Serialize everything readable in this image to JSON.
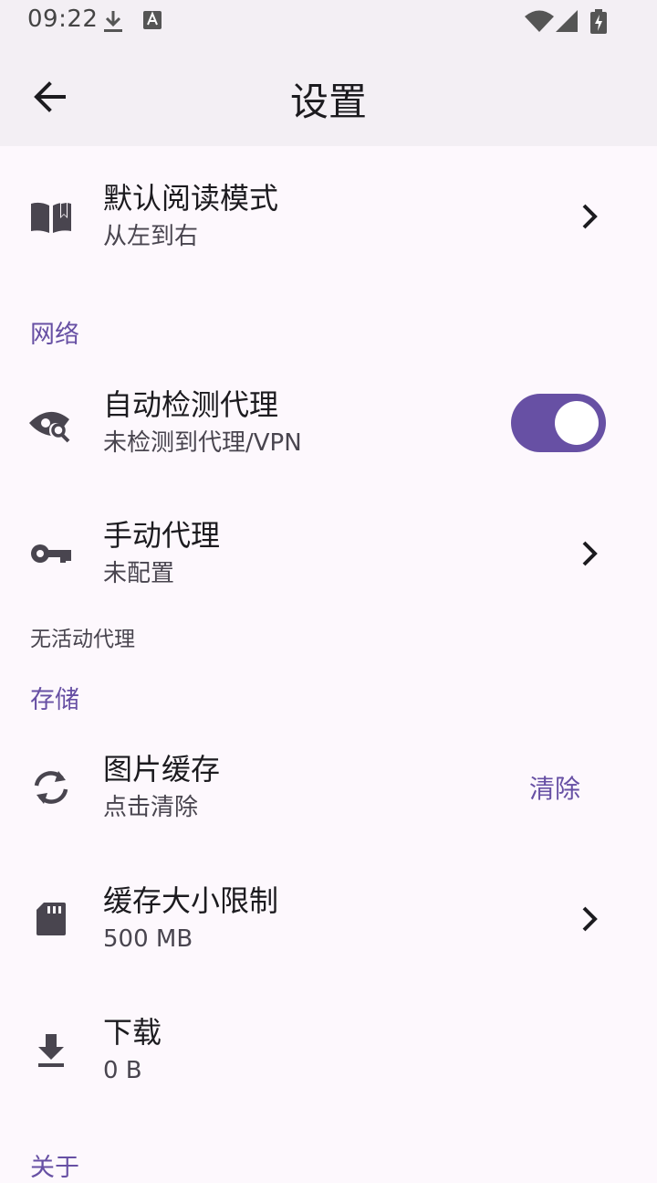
{
  "status_bar": {
    "time": "09:22"
  },
  "app_bar": {
    "title": "设置"
  },
  "items": {
    "reading_mode": {
      "title": "默认阅读模式",
      "subtitle": "从左到右"
    },
    "auto_proxy": {
      "title": "自动检测代理",
      "subtitle": "未检测到代理/VPN",
      "enabled": true
    },
    "manual_proxy": {
      "title": "手动代理",
      "subtitle": "未配置"
    },
    "image_cache": {
      "title": "图片缓存",
      "subtitle": "点击清除",
      "action": "清除"
    },
    "cache_limit": {
      "title": "缓存大小限制",
      "subtitle": "500 MB"
    },
    "downloads": {
      "title": "下载",
      "subtitle": "0 B"
    }
  },
  "sections": {
    "network": "网络",
    "storage": "存储",
    "about": "关于"
  },
  "notes": {
    "no_active_proxy": "无活动代理"
  },
  "colors": {
    "accent": "#6750a4",
    "surface": "#fdf8fd",
    "bar": "#f3eff4"
  },
  "icons": {
    "reading_mode": "book-open-icon",
    "auto_proxy": "eye-search-icon",
    "manual_proxy": "key-icon",
    "image_cache": "sync-icon",
    "cache_limit": "sd-card-icon",
    "downloads": "download-icon"
  }
}
